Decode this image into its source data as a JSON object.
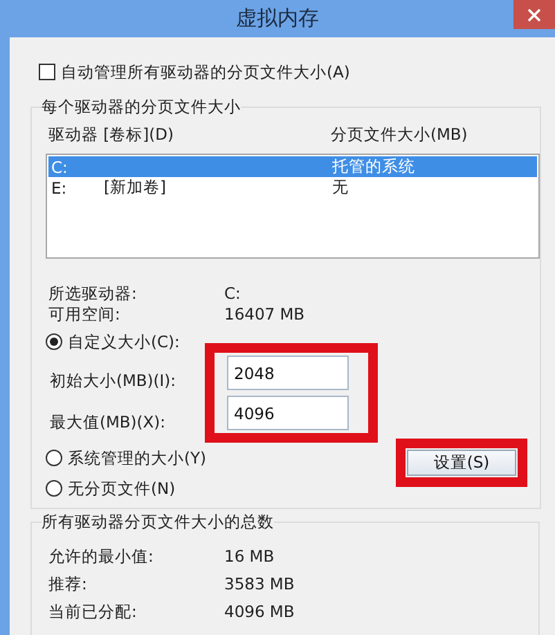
{
  "window": {
    "title": "虚拟内存"
  },
  "auto_manage": {
    "label": "自动管理所有驱动器的分页文件大小(A)",
    "checked": false
  },
  "per_drive": {
    "title": "每个驱动器的分页文件大小",
    "columns": [
      "驱动器 [卷标](D)",
      "分页文件大小(MB)"
    ],
    "drives": [
      {
        "drive": "C:",
        "size": "托管的系统",
        "selected": true
      },
      {
        "drive": "E:",
        "volume": "[新加卷]",
        "size": "无",
        "selected": false
      }
    ]
  },
  "selected_drive": {
    "label": "所选驱动器:",
    "value": "C:"
  },
  "free_space": {
    "label": "可用空间:",
    "value": "16407 MB"
  },
  "options": [
    {
      "label": "自定义大小(C):",
      "selected": true
    },
    {
      "label": "系统管理的大小(Y)",
      "selected": false
    },
    {
      "label": "无分页文件(N)",
      "selected": false
    }
  ],
  "initial_size": {
    "label": "初始大小(MB)(I):",
    "value": "2048"
  },
  "maximum_size": {
    "label": "最大值(MB)(X):",
    "value": "4096"
  },
  "size_fields_highlighted": true,
  "set_button": {
    "label": "设置(S)",
    "highlighted": true
  },
  "totals": {
    "title": "所有驱动器分页文件大小的总数",
    "rows": [
      {
        "label": "允许的最小值:",
        "value": "16 MB"
      },
      {
        "label": "推荐:",
        "value": "3583 MB"
      },
      {
        "label": "当前已分配:",
        "value": "4096 MB"
      }
    ]
  }
}
